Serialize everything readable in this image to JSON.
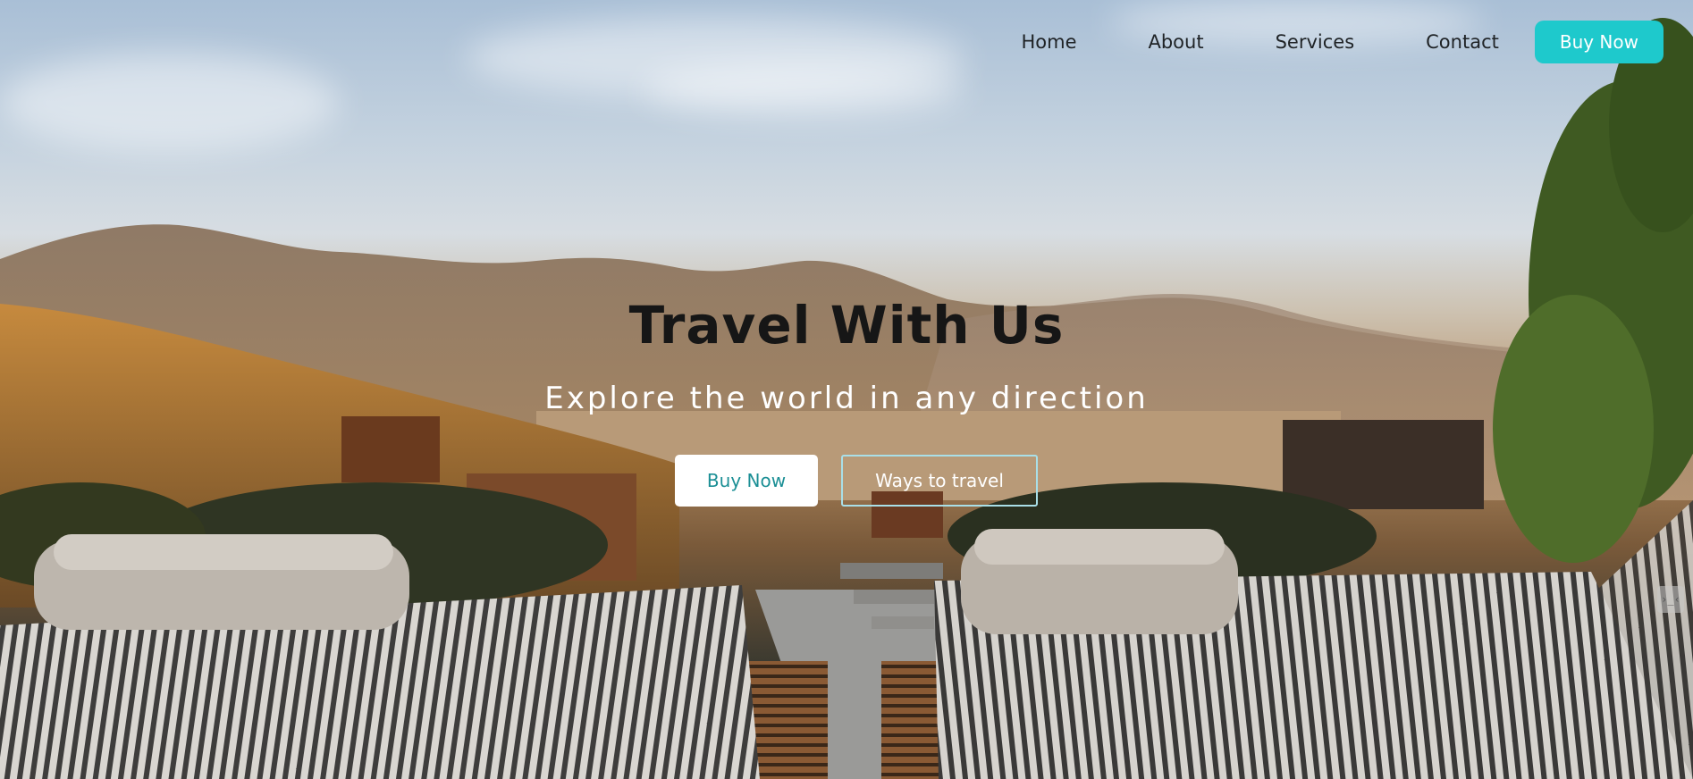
{
  "nav": {
    "links": [
      "Home",
      "About",
      "Services",
      "Contact"
    ],
    "buy_label": "Buy Now"
  },
  "hero": {
    "title": "Travel With Us",
    "subtitle": "Explore the world in any direction",
    "primary_cta": "Buy Now",
    "secondary_cta": "Ways to travel"
  },
  "colors": {
    "accent": "#1ec9cc",
    "primary_cta_text": "#1b8f95",
    "secondary_border": "#a9dfe8"
  },
  "widget": {
    "icon": "code-icon",
    "glyph": "›_‹"
  }
}
